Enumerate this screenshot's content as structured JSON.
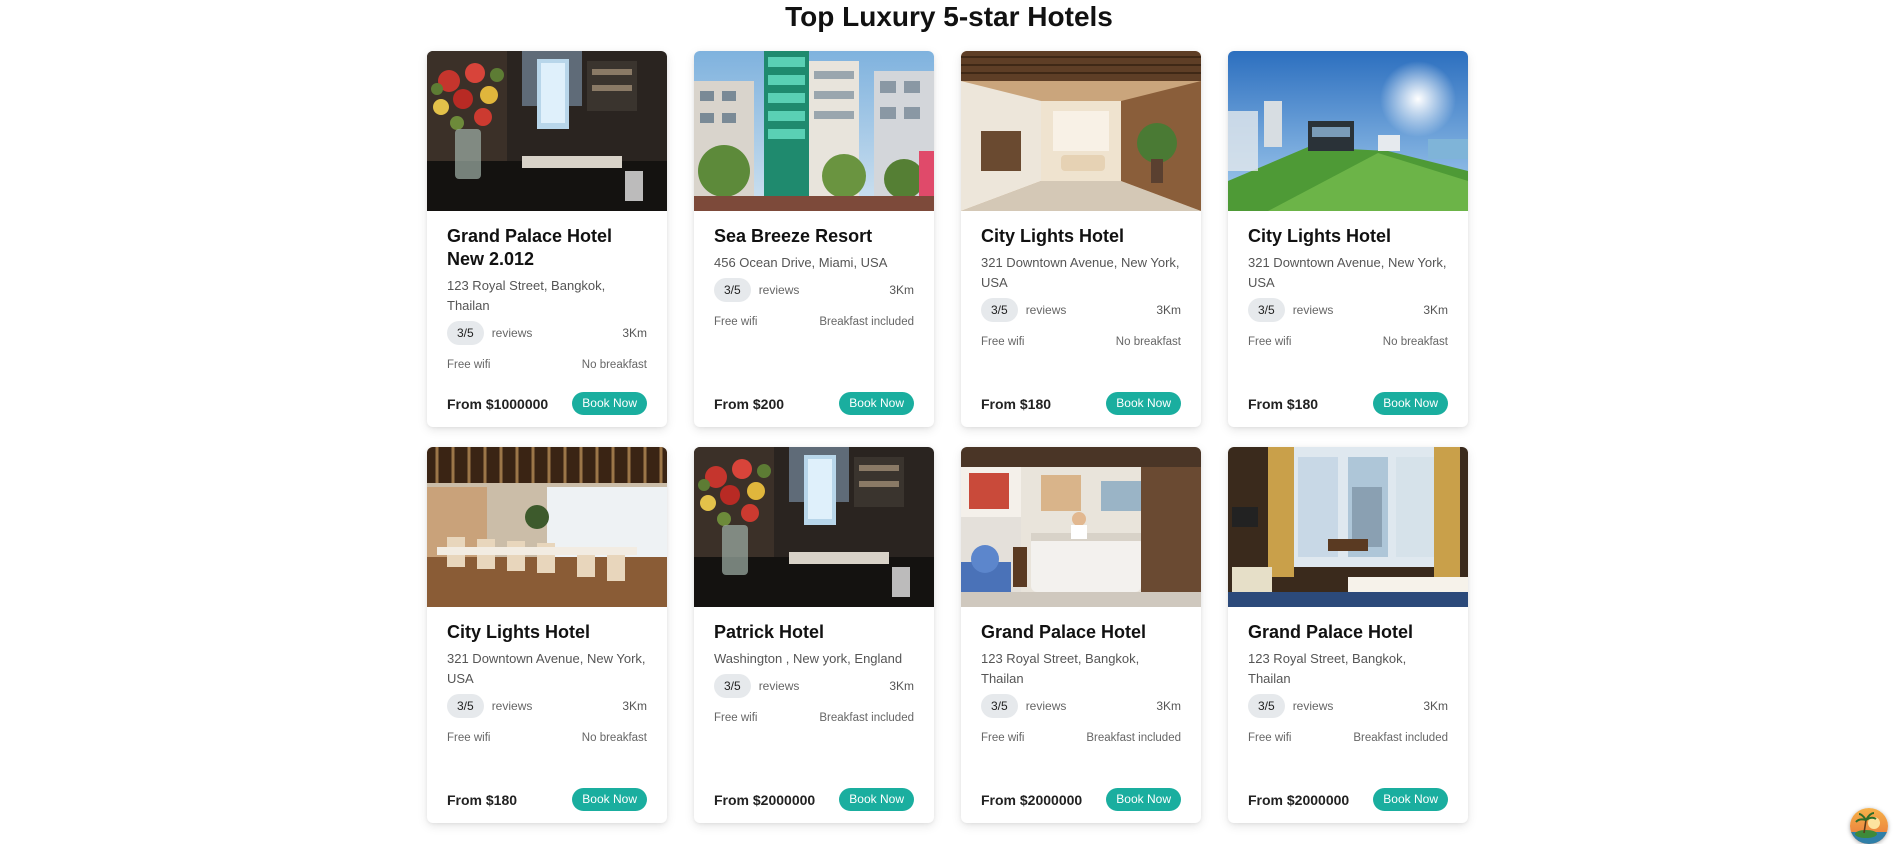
{
  "page": {
    "title": "Top Luxury 5-star Hotels"
  },
  "hotels": [
    {
      "name": "Grand Palace Hotel New 2.012",
      "address": "123 Royal Street, Bangkok, Thailan",
      "rating": "3/5",
      "reviews": "reviews",
      "distance": "3Km",
      "wifi": "Free wifi",
      "breakfast": "No breakfast",
      "price": "From $1000000",
      "book": "Book Now",
      "image": "lobby-flowers"
    },
    {
      "name": "Sea Breeze Resort",
      "address": "456 Ocean Drive, Miami, USA",
      "rating": "3/5",
      "reviews": "reviews",
      "distance": "3Km",
      "wifi": "Free wifi",
      "breakfast": "Breakfast included",
      "price": "From $200",
      "book": "Book Now",
      "image": "city-street"
    },
    {
      "name": "City Lights Hotel",
      "address": "321 Downtown Avenue, New York, USA",
      "rating": "3/5",
      "reviews": "reviews",
      "distance": "3Km",
      "wifi": "Free wifi",
      "breakfast": "No breakfast",
      "price": "From $180",
      "book": "Book Now",
      "image": "hallway-lounge"
    },
    {
      "name": "City Lights Hotel",
      "address": "321 Downtown Avenue, New York, USA",
      "rating": "3/5",
      "reviews": "reviews",
      "distance": "3Km",
      "wifi": "Free wifi",
      "breakfast": "No breakfast",
      "price": "From $180",
      "book": "Book Now",
      "image": "coastal-villa"
    },
    {
      "name": "City Lights Hotel",
      "address": "321 Downtown Avenue, New York, USA",
      "rating": "3/5",
      "reviews": "reviews",
      "distance": "3Km",
      "wifi": "Free wifi",
      "breakfast": "No breakfast",
      "price": "From $180",
      "book": "Book Now",
      "image": "dining-room"
    },
    {
      "name": "Patrick Hotel",
      "address": "Washington , New york, England",
      "rating": "3/5",
      "reviews": "reviews",
      "distance": "3Km",
      "wifi": "Free wifi",
      "breakfast": "Breakfast included",
      "price": "From $2000000",
      "book": "Book Now",
      "image": "lobby-flowers"
    },
    {
      "name": "Grand Palace Hotel",
      "address": "123 Royal Street, Bangkok, Thailan",
      "rating": "3/5",
      "reviews": "reviews",
      "distance": "3Km",
      "wifi": "Free wifi",
      "breakfast": "Breakfast included",
      "price": "From $2000000",
      "book": "Book Now",
      "image": "reception-desk"
    },
    {
      "name": "Grand Palace Hotel",
      "address": "123 Royal Street, Bangkok, Thailan",
      "rating": "3/5",
      "reviews": "reviews",
      "distance": "3Km",
      "wifi": "Free wifi",
      "breakfast": "Breakfast included",
      "price": "From $2000000",
      "book": "Book Now",
      "image": "bedroom-window"
    }
  ],
  "corner_widget": {
    "icon": "island-sunset-icon"
  }
}
